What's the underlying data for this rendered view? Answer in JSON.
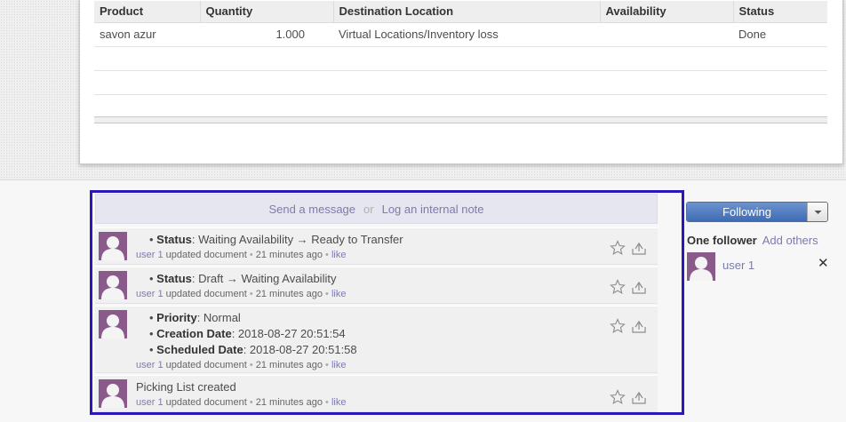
{
  "moves_table": {
    "headers": [
      "Product",
      "Quantity",
      "Destination Location",
      "Availability",
      "Status"
    ],
    "rows": [
      [
        "savon azur",
        "1.000",
        "Virtual Locations/Inventory loss",
        "",
        "Done"
      ]
    ]
  },
  "chatter": {
    "compose": {
      "send_message": "Send a message",
      "or": "or",
      "log_note": "Log an internal note"
    },
    "messages": [
      {
        "lines": [
          {
            "label": "Status",
            "value": ": Waiting Availability → Ready to Transfer"
          }
        ],
        "author": "user 1",
        "action": "updated document",
        "time": "21 minutes ago",
        "like": "like"
      },
      {
        "lines": [
          {
            "label": "Status",
            "value": ": Draft → Waiting Availability"
          }
        ],
        "author": "user 1",
        "action": "updated document",
        "time": "21 minutes ago",
        "like": "like"
      },
      {
        "lines": [
          {
            "label": "Priority",
            "value": ": Normal"
          },
          {
            "label": "Creation Date",
            "value": ": 2018-08-27 20:51:54"
          },
          {
            "label": "Scheduled Date",
            "value": ": 2018-08-27 20:51:58"
          }
        ],
        "author": "user 1",
        "action": "updated document",
        "time": "21 minutes ago",
        "like": "like"
      },
      {
        "text": "Picking List created",
        "author": "user 1",
        "action": "updated document",
        "time": "21 minutes ago",
        "like": "like"
      }
    ]
  },
  "followers": {
    "button_label": "Following",
    "count_label": "One follower",
    "add_others": "Add others",
    "list": [
      {
        "name": "user 1",
        "remove": "✕"
      }
    ]
  },
  "colors": {
    "highlight_border": "#2b18b8",
    "link": "#7c7bad",
    "avatar_bg": "#8a5a8a",
    "button_blue": "#4f7cc0"
  },
  "icons": [
    "star-icon",
    "reply-icon",
    "avatar-icon",
    "chevron-down-icon",
    "close-icon"
  ]
}
